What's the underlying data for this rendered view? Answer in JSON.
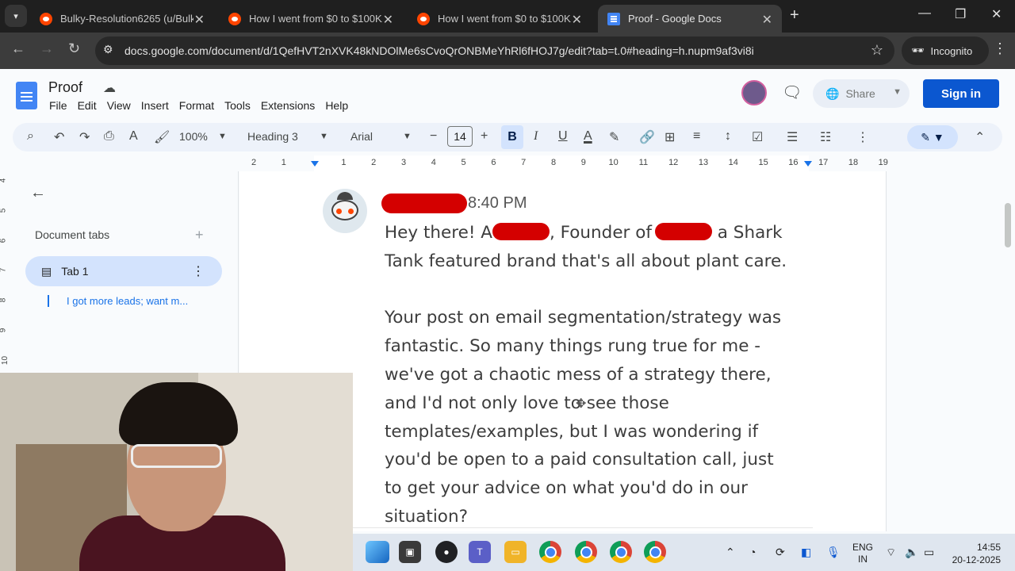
{
  "browser": {
    "tabs": [
      {
        "title": "Bulky-Resolution6265 (u/Bulky-",
        "active": false
      },
      {
        "title": "How I went from $0 to $100K/m",
        "active": false
      },
      {
        "title": "How I went from $0 to $100K/m",
        "active": false
      },
      {
        "title": "Proof - Google Docs",
        "active": true
      }
    ],
    "url": "docs.google.com/document/d/1QefHVT2nXVK48kNDOlMe6sCvoQrONBMeYhRl6fHOJ7g/edit?tab=t.0#heading=h.nupm9af3vi8i",
    "incognito_label": "Incognito"
  },
  "docs": {
    "title": "Proof",
    "menu": [
      "File",
      "Edit",
      "View",
      "Insert",
      "Format",
      "Tools",
      "Extensions",
      "Help"
    ],
    "share_label": "Share",
    "signin_label": "Sign in",
    "toolbar": {
      "zoom": "100%",
      "style": "Heading 3",
      "font": "Arial",
      "font_size": "14"
    },
    "ruler_numbers": [
      "2",
      "1",
      "1",
      "2",
      "3",
      "4",
      "5",
      "6",
      "7",
      "8",
      "9",
      "10",
      "11",
      "12",
      "13",
      "14",
      "15",
      "16",
      "17",
      "18",
      "19"
    ],
    "vruler_numbers": [
      "4",
      "5",
      "6",
      "7",
      "8",
      "9",
      "10"
    ],
    "sidebar": {
      "title": "Document tabs",
      "tab_label": "Tab 1",
      "outline_item": "I got more leads; want m..."
    },
    "document": {
      "timestamp": "8:40 PM",
      "greeting_lead": "Hey there! A",
      "greeting_mid": ", Founder of",
      "greeting_tail": "a Shark",
      "line2": "Tank featured brand that's all about plant care.",
      "para2": [
        "Your post on email segmentation/strategy was",
        "fantastic. So many things rung true for me -",
        "we've got a chaotic mess of a strategy there,",
        "and I'd not only love to see those",
        "templates/examples, but I was wondering if",
        "you'd be open to a paid consultation call, just",
        "to get your advice on what you'd do in our",
        "situation?"
      ]
    }
  },
  "taskbar": {
    "lang_top": "ENG",
    "lang_bottom": "IN",
    "time": "14:55",
    "date": "20-12-2025"
  },
  "colors": {
    "accent": "#0b57d0",
    "redaction": "#d40000",
    "reddit": "#ff4500"
  }
}
